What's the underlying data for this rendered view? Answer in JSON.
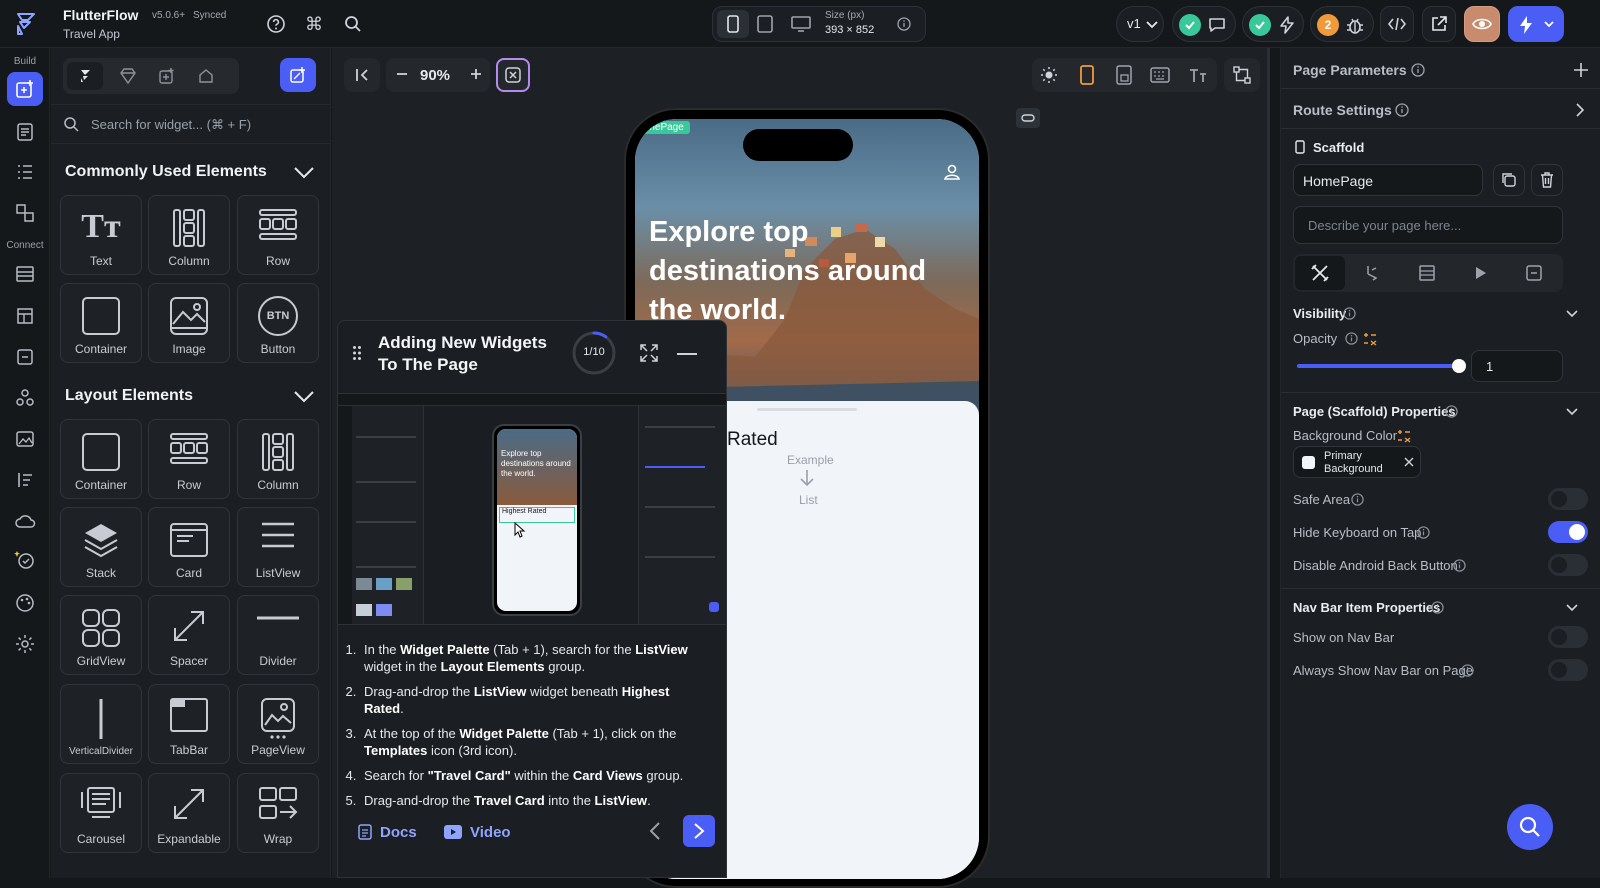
{
  "app": {
    "name": "FlutterFlow",
    "version": "v5.0.6+",
    "sync": "Synced",
    "project": "Travel App"
  },
  "toolbar": {
    "size_label": "Size (px)",
    "size_value": "393 × 852",
    "version_select": "v1",
    "notification_count": "2",
    "zoom": "90%"
  },
  "rail": {
    "build_label": "Build",
    "connect_label": "Connect"
  },
  "palette": {
    "search_placeholder": "Search for widget... (⌘ + F)",
    "common_title": "Commonly Used Elements",
    "common_items": [
      "Text",
      "Column",
      "Row",
      "Container",
      "Image",
      "Button"
    ],
    "layout_title": "Layout Elements",
    "layout_items": [
      "Container",
      "Row",
      "Column",
      "Stack",
      "Card",
      "ListView",
      "GridView",
      "Spacer",
      "Divider",
      "VerticalDivider",
      "TabBar",
      "PageView",
      "Carousel",
      "Expandable",
      "Wrap"
    ],
    "btn_icon_text": "BTN"
  },
  "phone": {
    "page_tag": "omePage",
    "hero_title": "Explore top destinations around the world.",
    "section_title": "Rated",
    "example_label": "Example",
    "list_label": "List"
  },
  "tutorial": {
    "title": "Adding New Widgets To The Page",
    "progress": "1/10",
    "progress_fraction": 0.1,
    "mini_hero": "Explore top destinations around the world.",
    "mini_section": "Highest Rated",
    "docs_label": "Docs",
    "video_label": "Video",
    "steps": [
      {
        "a": "In the ",
        "b": "Widget Palette",
        "c": " (Tab + 1), search for the ",
        "d": "ListView",
        "e": " widget in the ",
        "f": "Layout Elements",
        "g": " group."
      },
      {
        "a": "Drag-and-drop the ",
        "b": "ListView",
        "c": " widget beneath ",
        "d": "Highest Rated",
        "e": ".",
        "f": "",
        "g": ""
      },
      {
        "a": "At the top of the ",
        "b": "Widget Palette",
        "c": " (Tab + 1), click on the ",
        "d": "Templates",
        "e": " icon (3rd icon).",
        "f": "",
        "g": ""
      },
      {
        "a": "Search for ",
        "b": "\"Travel Card\"",
        "c": " within the ",
        "d": "Card Views",
        "e": " group.",
        "f": "",
        "g": ""
      },
      {
        "a": "Drag-and-drop the ",
        "b": "Travel Card",
        "c": " into the ",
        "d": "ListView",
        "e": ".",
        "f": "",
        "g": ""
      }
    ]
  },
  "props": {
    "page_parameters": "Page Parameters",
    "route_settings": "Route Settings",
    "scaffold": "Scaffold",
    "page_name": "HomePage",
    "describe_placeholder": "Describe your page here...",
    "visibility": "Visibility",
    "opacity_label": "Opacity",
    "opacity_value": "1",
    "opacity_fraction": 1.0,
    "scaffold_props": "Page (Scaffold) Properties",
    "bg_color_label": "Background Color",
    "bg_color_value": "Primary Background",
    "safe_area": "Safe Area",
    "hide_keyboard": "Hide Keyboard on Tap",
    "disable_back": "Disable Android Back Button",
    "nav_bar_props": "Nav Bar Item Properties",
    "show_nav_bar": "Show on Nav Bar",
    "always_show_nav": "Always Show Nav Bar on Page",
    "toggles": {
      "safe_area": false,
      "hide_keyboard": true,
      "disable_back": false,
      "show_nav_bar": false,
      "always_show_nav": false
    }
  },
  "colors": {
    "accent": "#4a5ef6",
    "green": "#38c89a",
    "orange": "#f09a3a",
    "bg": "#14181b"
  }
}
